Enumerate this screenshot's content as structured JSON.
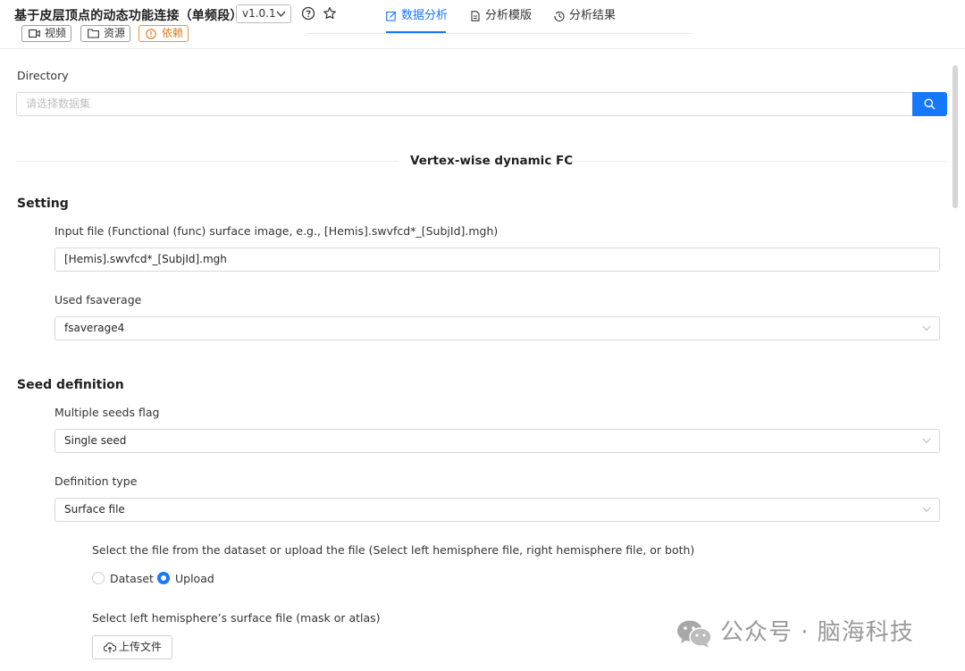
{
  "header": {
    "title": "基于皮层顶点的动态功能连接（单频段）",
    "version": "v1.0.1",
    "buttons": {
      "video": "视频",
      "resource": "资源",
      "dependency": "依赖"
    },
    "tabs": [
      {
        "label": "数据分析",
        "icon": "edit-icon",
        "active": true
      },
      {
        "label": "分析模版",
        "icon": "file-icon",
        "active": false
      },
      {
        "label": "分析结果",
        "icon": "history-icon",
        "active": false
      }
    ]
  },
  "directory": {
    "label": "Directory",
    "placeholder": "请选择数据集"
  },
  "form_title": "Vertex-wise dynamic FC",
  "setting": {
    "title": "Setting",
    "input_file": {
      "label": "Input file (Functional (func) surface image, e.g., [Hemis].swvfcd*_[SubjId].mgh)",
      "value": "[Hemis].swvfcd*_[SubjId].mgh"
    },
    "fsaverage": {
      "label": "Used fsaverage",
      "value": "fsaverage4"
    }
  },
  "seed": {
    "title": "Seed definition",
    "multiple": {
      "label": "Multiple seeds flag",
      "value": "Single seed"
    },
    "definition": {
      "label": "Definition type",
      "value": "Surface file"
    },
    "source": {
      "label": "Select the file from the dataset or upload the file (Select left hemisphere file, right hemisphere file, or both)",
      "options": [
        "Dataset",
        "Upload"
      ],
      "selected": "Upload"
    },
    "left_file": {
      "label": "Select left hemisphere’s surface file (mask or atlas)",
      "upload_label": "上传文件"
    }
  },
  "watermark": "公众号 · 脑海科技",
  "colors": {
    "accent": "#1677ff",
    "warning": "#f0923a"
  }
}
